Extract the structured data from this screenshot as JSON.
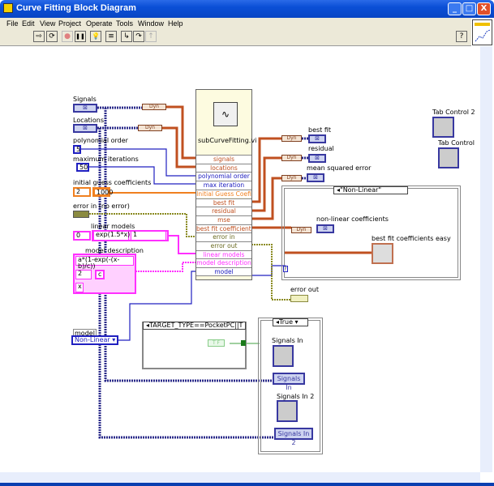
{
  "window": {
    "title": "Curve Fitting Block Diagram",
    "min": "_",
    "max": "□",
    "close": "X"
  },
  "menu": [
    "File",
    "Edit",
    "View",
    "Project",
    "Operate",
    "Tools",
    "Window",
    "Help"
  ],
  "toolbar": {
    "run": "⇨",
    "run_continuous": "⟳",
    "abort": "●",
    "pause": "❚❚",
    "highlight": "💡",
    "retain": "≡",
    "step_into": "↳",
    "step_over": "↷",
    "step_out": "↑",
    "help": "?"
  },
  "controls": {
    "signals": {
      "label": "Signals"
    },
    "locations": {
      "label": "Locations"
    },
    "polynomial_order": {
      "label": "polynomial order",
      "value": "5"
    },
    "max_iterations": {
      "label": "maximum iterations",
      "value": "50"
    },
    "initial_guess": {
      "label": "initial guess coefficients",
      "index": "2",
      "value": "1000"
    },
    "error_in": {
      "label": "error in (no error)"
    },
    "linear_models": {
      "label": "linear models",
      "index": "0",
      "value1": "exp(1.5*x)",
      "value2": "1"
    },
    "model_description": {
      "label": "model description",
      "formula": "a*(1-exp(-(x-b)/c))",
      "index": "2",
      "param": "c",
      "variable": "x"
    },
    "model": {
      "label": "model",
      "value": "Non-Linear"
    }
  },
  "subvi": {
    "name": "subCurveFitting.vi",
    "terminals": [
      "signals",
      "locations",
      "polynomial order",
      "max iteration",
      "Initial Guess Coefi",
      "best fit",
      "residual",
      "mse",
      "best fit coefficients",
      "error in",
      "error out",
      "linear models",
      "model description",
      "model"
    ]
  },
  "converters": {
    "to_dyn": "Dyn",
    "from_dyn": "Dyn"
  },
  "indicators": {
    "best_fit": "best fit",
    "residual": "residual",
    "mse": "mean squared error",
    "nonlinear_coeff": "non-linear coefficients",
    "best_fit_easy": "best fit coefficients easy",
    "error_out": "error out",
    "tab_control_2": "Tab Control 2",
    "tab_control": "Tab Control",
    "signals_in_graph": "Signals In",
    "signals_in": "Signals In",
    "signals_in_2_graph": "Signals In 2",
    "signals_in_2": "Signals In 2"
  },
  "structures": {
    "case_nonlinear": "\"Non-Linear\"",
    "conditional": "TARGET_TYPE==PocketPC||T",
    "case_true": "True",
    "bool_const": "T F"
  }
}
